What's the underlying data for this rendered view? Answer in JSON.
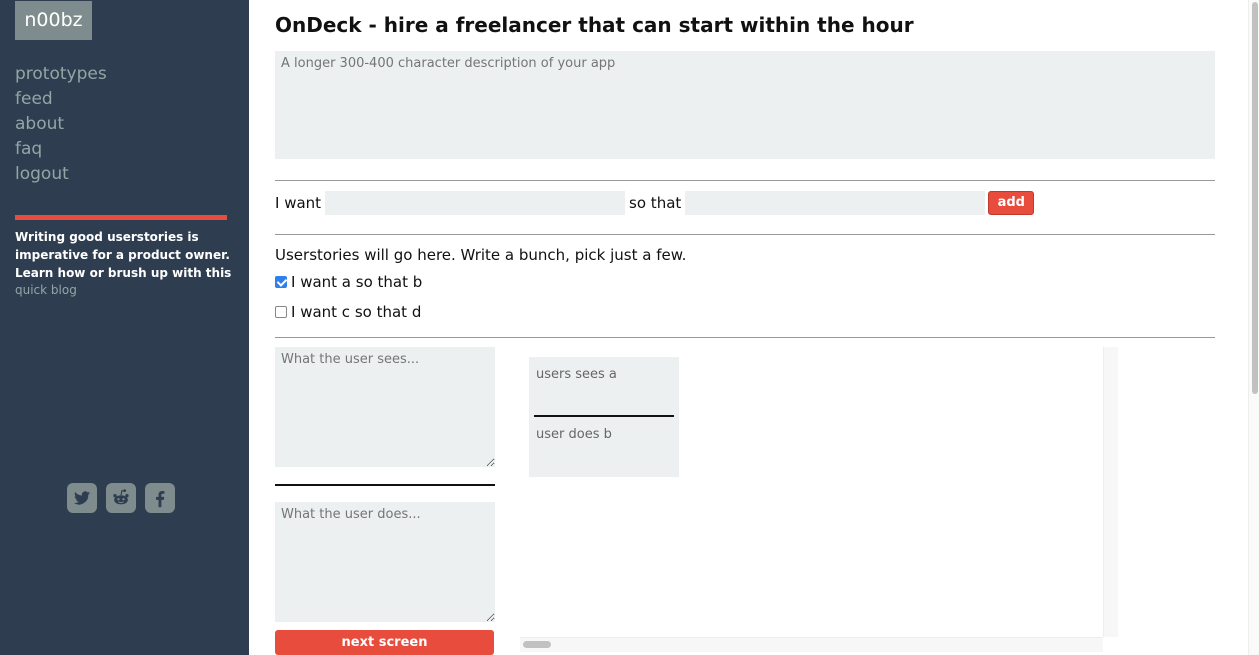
{
  "sidebar": {
    "logo": "n00bz",
    "nav": [
      "prototypes",
      "feed",
      "about",
      "faq",
      "logout"
    ],
    "tip": "Writing good userstories is imperative for a product owner. Learn how or brush up with this",
    "tip_link": "quick blog",
    "social": [
      "twitter-icon",
      "reddit-icon",
      "facebook-icon"
    ],
    "accent": "#e74c3c",
    "background": "#2e3e50"
  },
  "main": {
    "title": "OnDeck - hire a freelancer that can start within the hour",
    "description_placeholder": "A longer 300-400 character description of your app",
    "story_input": {
      "i_want_label": "I want",
      "i_want_value": "",
      "so_that_label": "so that",
      "so_that_value": "",
      "add_label": "add"
    },
    "stories_caption": "Userstories will go here. Write a bunch, pick just a few.",
    "stories": [
      {
        "label": "I want a so that b",
        "checked": true
      },
      {
        "label": "I want c so that d",
        "checked": false
      }
    ],
    "screen_editor": {
      "sees_placeholder": "What the user sees...",
      "does_placeholder": "What the user does...",
      "next_label": "next screen"
    },
    "screen_card": {
      "sees": "users sees a",
      "does": "user does b"
    }
  }
}
